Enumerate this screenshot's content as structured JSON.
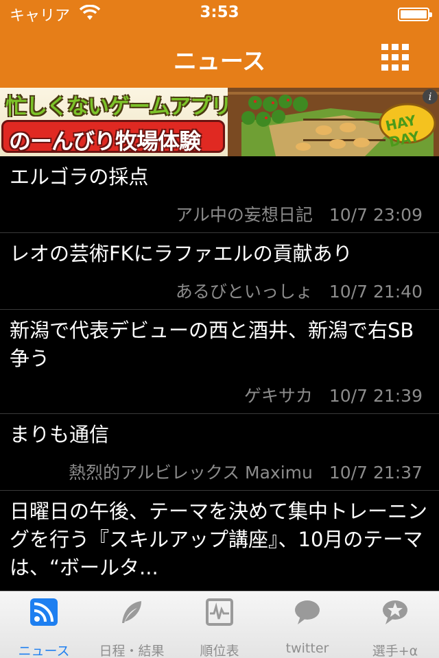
{
  "status_bar": {
    "carrier": "キャリア",
    "time": "3:53"
  },
  "header": {
    "title": "ニュース",
    "menu_icon": "grid-icon"
  },
  "banner": {
    "line1": "忙しくないゲームアプリ",
    "line2": "のーんびり牧場体験",
    "logo_text": "HAY DAY",
    "info_icon": "info-icon"
  },
  "news": [
    {
      "title": "エルゴラの採点",
      "source": "アル中の妄想日記",
      "date": "10/7 23:09"
    },
    {
      "title": "レオの芸術FKにラファエルの貢献あり",
      "source": "あるびといっしょ",
      "date": "10/7 21:40"
    },
    {
      "title": "新潟で代表デビューの西と酒井、新潟で右SB争う",
      "source": "ゲキサカ",
      "date": "10/7 21:39"
    },
    {
      "title": "まりも通信",
      "source": "熱烈的アルビレックス Maximu",
      "date": "10/7 21:37"
    },
    {
      "title": "日曜日の午後、テーマを決めて集中トレーニングを行う『スキルアップ講座』、10月のテーマは、“ボールタ...",
      "source": "",
      "date": ""
    }
  ],
  "tabs": [
    {
      "label": "ニュース",
      "icon": "rss-icon",
      "active": true
    },
    {
      "label": "日程・結果",
      "icon": "feather-icon",
      "active": false
    },
    {
      "label": "順位表",
      "icon": "chart-icon",
      "active": false
    },
    {
      "label": "twitter",
      "icon": "speech-bubble-icon",
      "active": false
    },
    {
      "label": "選手+α",
      "icon": "star-bubble-icon",
      "active": false
    }
  ],
  "colors": {
    "accent": "#e67e18",
    "active_tab": "#1e7ff0",
    "meta_text": "#8c8c8c"
  }
}
